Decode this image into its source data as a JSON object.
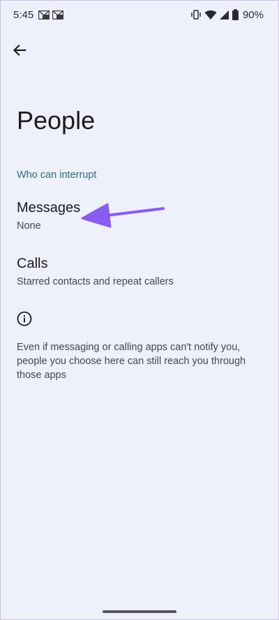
{
  "status_bar": {
    "time": "5:45",
    "battery": "90%",
    "icons": [
      "gmail-notification-icon",
      "gmail-notification-icon",
      "vibrate-icon",
      "wifi-icon",
      "signal-icon",
      "battery-icon"
    ]
  },
  "page": {
    "title": "People",
    "section_header": "Who can interrupt"
  },
  "items": [
    {
      "title": "Messages",
      "summary": "None"
    },
    {
      "title": "Calls",
      "summary": "Starred contacts and repeat callers"
    }
  ],
  "footer": {
    "text": "Even if messaging or calling apps can't notify you, people you choose here can still reach you through those apps"
  },
  "colors": {
    "background": "#eef1fb",
    "accent": "#2c6a7e",
    "annotation_arrow": "#8a5cf0"
  }
}
